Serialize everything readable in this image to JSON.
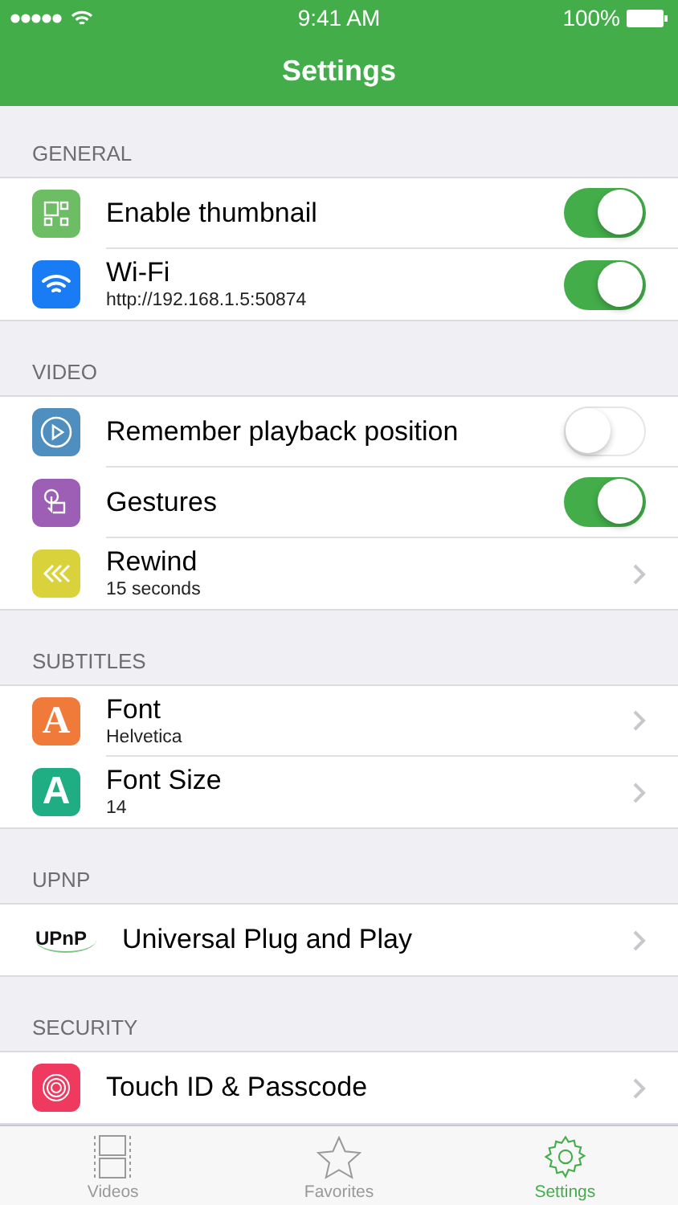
{
  "status_bar": {
    "time": "9:41 AM",
    "battery": "100%"
  },
  "nav": {
    "title": "Settings"
  },
  "sections": [
    {
      "header": "GENERAL",
      "rows": [
        {
          "title": "Enable thumbnail",
          "kind": "toggle",
          "on": true
        },
        {
          "title": "Wi-Fi",
          "subtitle": "http://192.168.1.5:50874",
          "kind": "toggle",
          "on": true
        }
      ]
    },
    {
      "header": "VIDEO",
      "rows": [
        {
          "title": "Remember playback position",
          "kind": "toggle",
          "on": false
        },
        {
          "title": "Gestures",
          "kind": "toggle",
          "on": true
        },
        {
          "title": "Rewind",
          "subtitle": "15 seconds",
          "kind": "chevron"
        }
      ]
    },
    {
      "header": "SUBTITLES",
      "rows": [
        {
          "glyph": "A",
          "title": "Font",
          "subtitle": "Helvetica",
          "kind": "chevron"
        },
        {
          "glyph": "A",
          "title": "Font Size",
          "subtitle": "14",
          "kind": "chevron"
        }
      ]
    },
    {
      "header": "UPNP",
      "rows": [
        {
          "logo": "UPnP",
          "title": "Universal Plug and Play",
          "kind": "chevron"
        }
      ]
    },
    {
      "header": "SECURITY",
      "rows": [
        {
          "title": "Touch ID & Passcode",
          "kind": "chevron"
        }
      ]
    }
  ],
  "tab_bar": [
    {
      "label": "Videos",
      "selected": false
    },
    {
      "label": "Favorites",
      "selected": false
    },
    {
      "label": "Settings",
      "selected": true
    }
  ]
}
